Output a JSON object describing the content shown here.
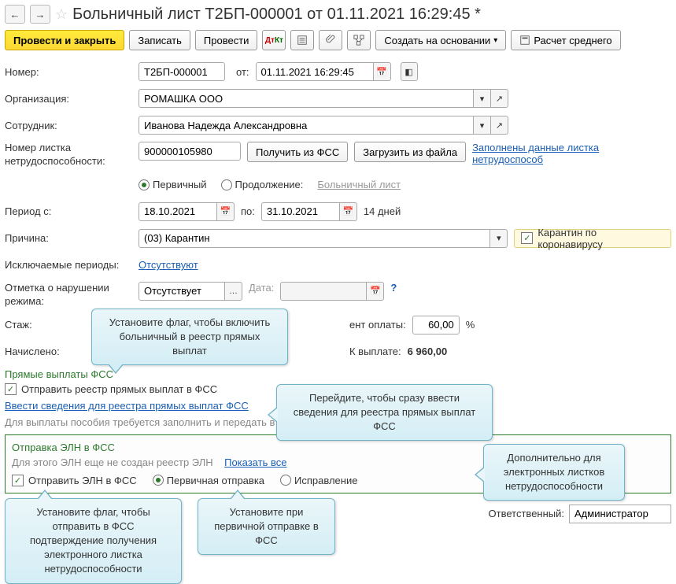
{
  "header": {
    "title": "Больничный лист Т2БП-000001 от 01.11.2021 16:29:45 *"
  },
  "toolbar": {
    "post_and_close": "Провести и закрыть",
    "save": "Записать",
    "post": "Провести",
    "create_based": "Создать на основании",
    "calc_avg": "Расчет среднего"
  },
  "fields": {
    "number_label": "Номер:",
    "number_value": "Т2БП-000001",
    "from_label": "от:",
    "from_value": "01.11.2021 16:29:45",
    "org_label": "Организация:",
    "org_value": "РОМАШКА ООО",
    "employee_label": "Сотрудник:",
    "employee_value": "Иванова Надежда Александровна",
    "sheet_no_label": "Номер листка нетрудоспособности:",
    "sheet_no_value": "900000105980",
    "get_from_fss": "Получить из ФСС",
    "load_from_file": "Загрузить из файла",
    "filled_link": "Заполнены данные листка нетрудоспособ",
    "primary": "Первичный",
    "continuation": "Продолжение:",
    "continuation_link": "Больничный лист",
    "period_from_label": "Период с:",
    "period_from_value": "18.10.2021",
    "period_to_label": "по:",
    "period_to_value": "31.10.2021",
    "days": "14 дней",
    "reason_label": "Причина:",
    "reason_value": "(03) Карантин",
    "coronavirus": "Карантин по коронавирусу",
    "excluded_periods_label": "Исключаемые периоды:",
    "excluded_periods_link": "Отсутствуют",
    "violation_label": "Отметка о нарушении режима:",
    "violation_value": "Отсутствует",
    "date_label": "Дата:",
    "experience_label": "Стаж:",
    "pay_percent_label": "ент оплаты:",
    "pay_percent_value": "60,00",
    "percent": "%",
    "accrued_label": "Начислено:",
    "to_pay_label": "К выплате:",
    "to_pay_value": "6 960,00",
    "direct_pay_title": "Прямые выплаты ФСС",
    "send_registry_checkbox": "Отправить реестр прямых выплат в ФСС",
    "enter_info_link": "Ввести сведения для реестра прямых выплат ФСС",
    "info_note": "Для выплаты пособия требуется заполнить и передать в ФСС сведения для реестра прямых выплат",
    "eln_title": "Отправка ЭЛН в ФСС",
    "eln_not_created": "Для этого ЭЛН еще не создан реестр ЭЛН",
    "show_all": "Показать все",
    "send_eln_checkbox": "Отправить ЭЛН в ФСС",
    "eln_primary": "Первичная отправка",
    "eln_fix": "Исправление",
    "responsible_label": "Ответственный:",
    "responsible_value": "Администратор"
  },
  "tooltips": {
    "t1": "Установите флаг, чтобы включить больничный в реестр прямых выплат",
    "t2": "Перейдите, чтобы сразу ввести сведения для реестра прямых выплат ФСС",
    "t3": "Дополнительно для электронных листков нетрудоспособности",
    "t4": "Установите флаг, чтобы отправить в ФСС подтверждение получения электронного листка нетрудоспособности",
    "t5": "Установите при первичной отправке в ФСС"
  }
}
